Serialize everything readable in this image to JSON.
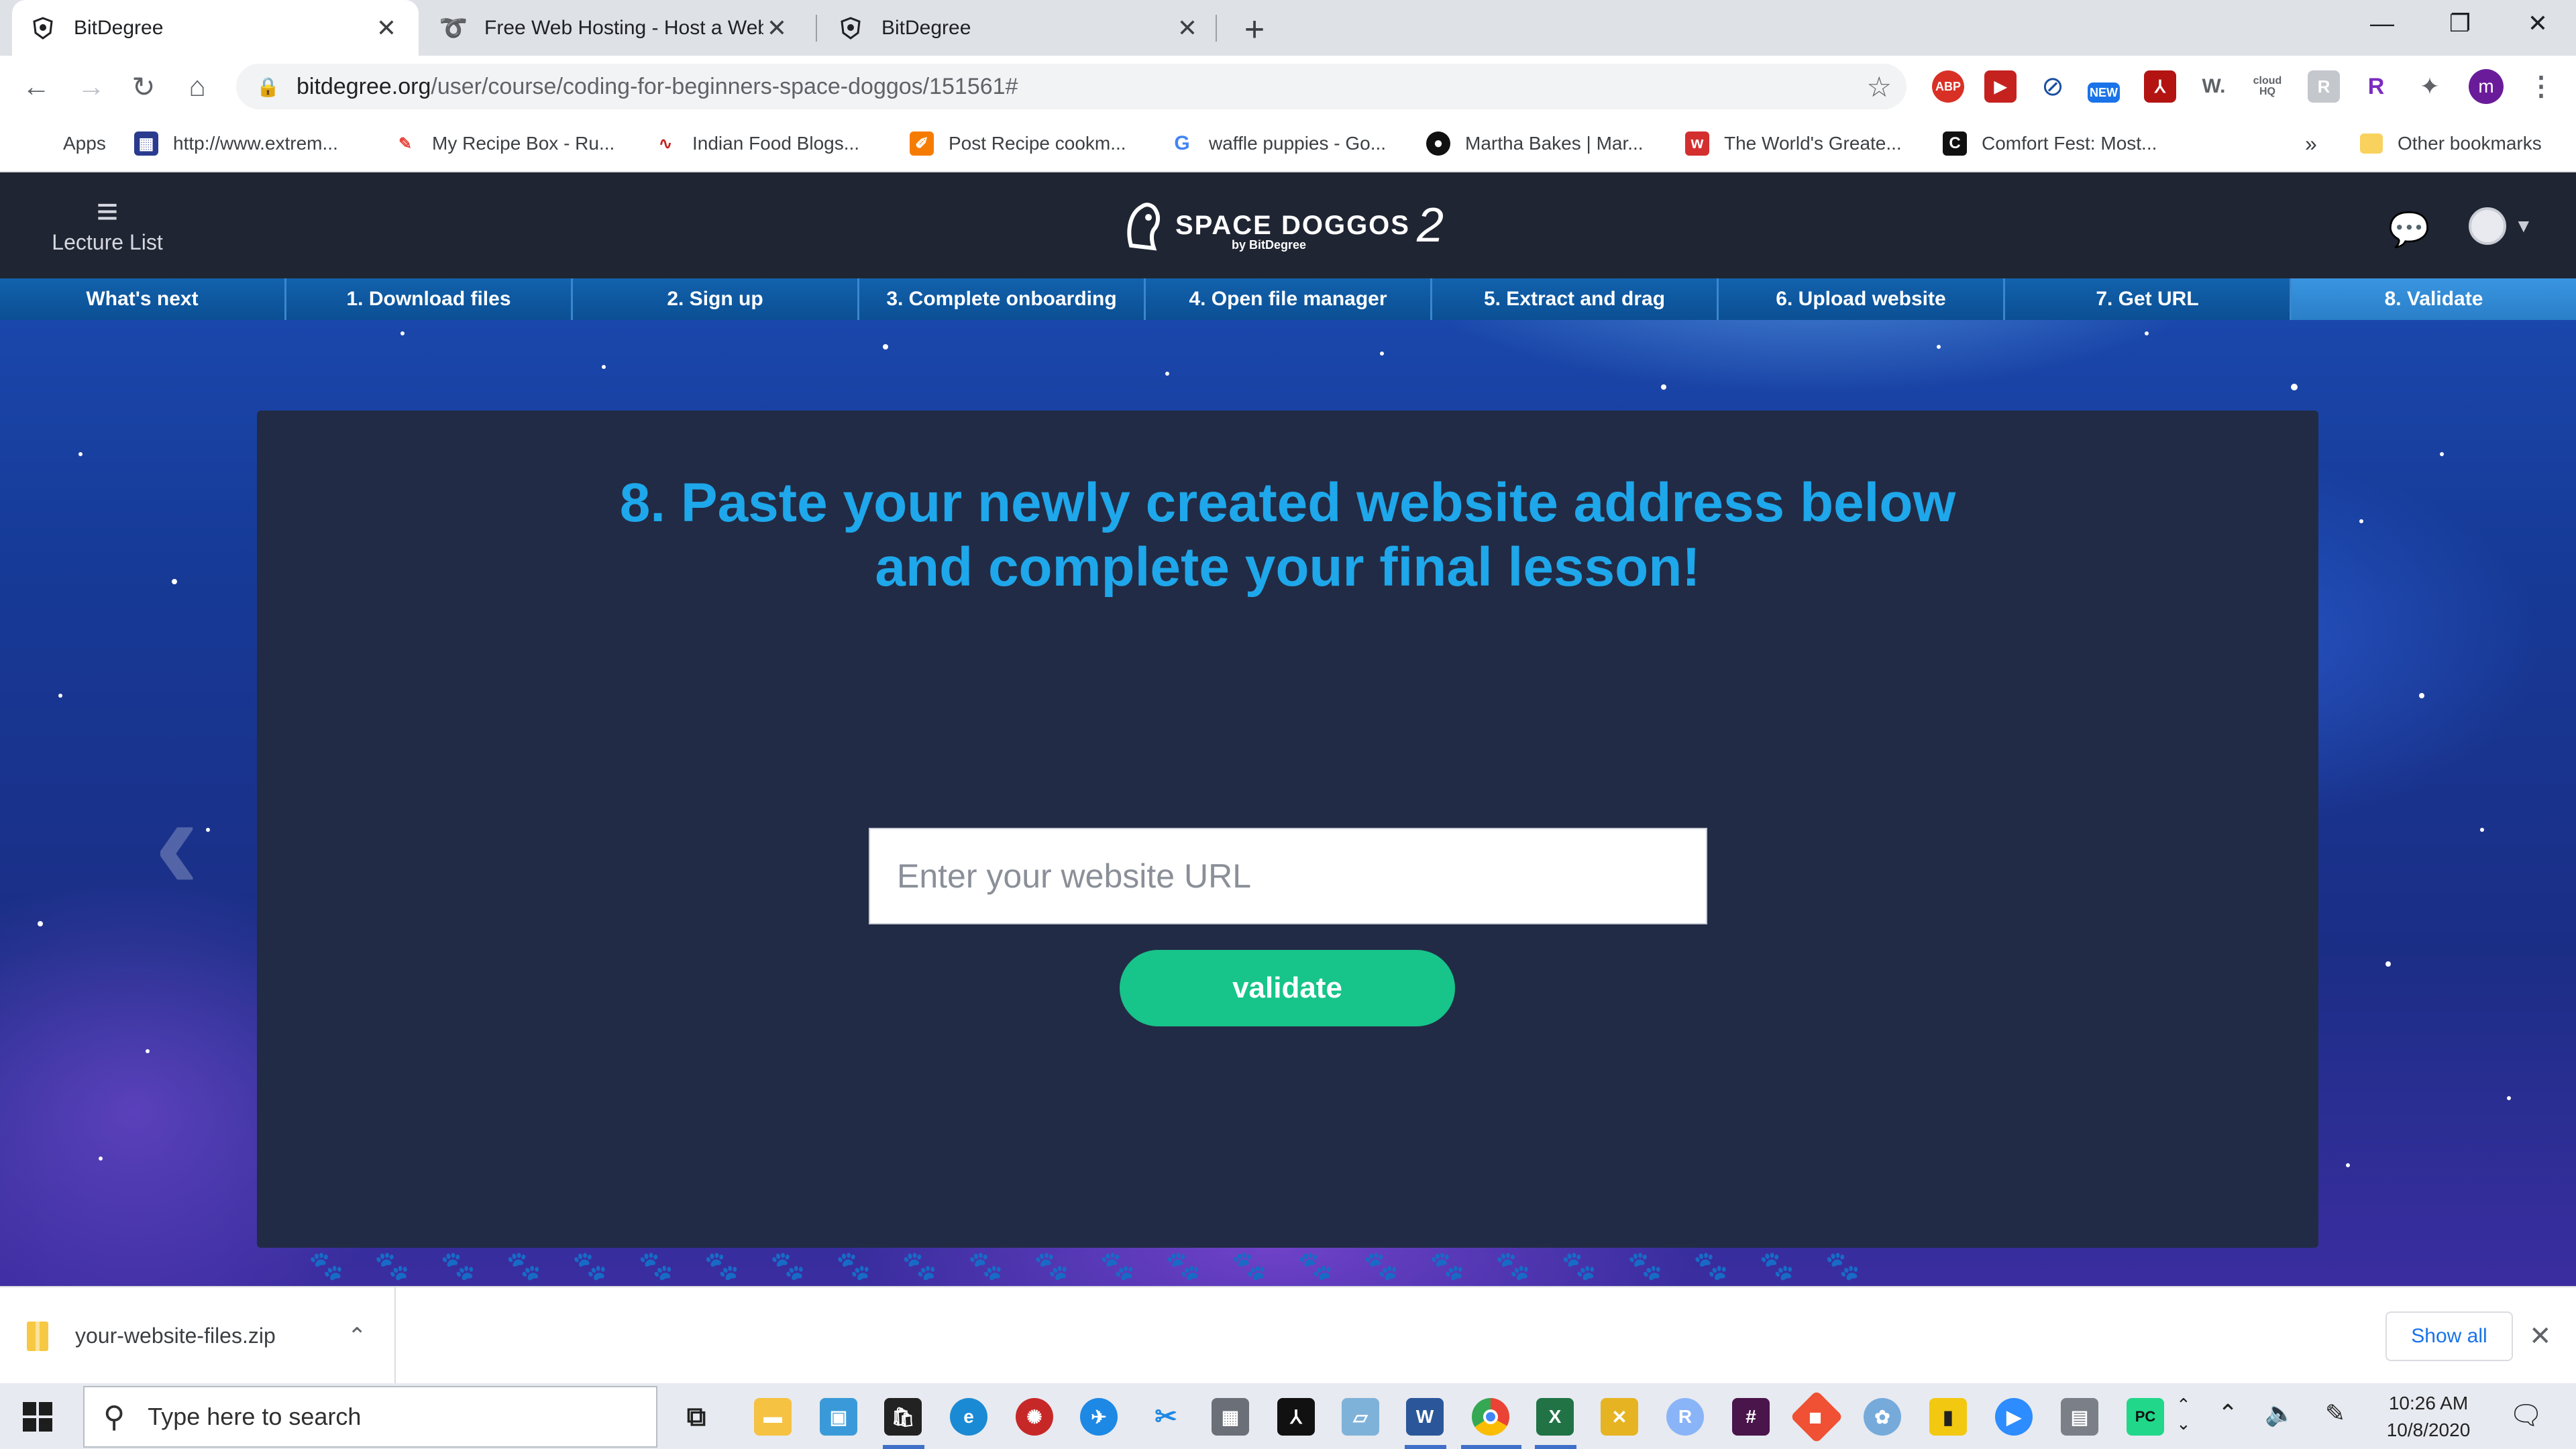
{
  "browser": {
    "tabs": [
      {
        "title": "BitDegree",
        "active": true
      },
      {
        "title": "Free Web Hosting - Host a Website",
        "active": false
      },
      {
        "title": "BitDegree",
        "active": false
      }
    ],
    "url_host": "bitdegree.org",
    "url_path": "/user/course/coding-for-beginners-space-doggos/151561#",
    "extensions": [
      "abp-icon",
      "playback-icon",
      "block-icon",
      "new-badge-icon",
      "pdf-icon",
      "w-icon",
      "cloudhq-icon",
      "r-icon",
      "r-purple-icon",
      "puzzle-icon"
    ],
    "extension_labels": {
      "abp": "ABP",
      "new": "NEW",
      "w": "W.",
      "cloud": "cloud HQ",
      "r": "R"
    },
    "profile_initial": "m"
  },
  "bookmarks": {
    "items": [
      {
        "label": "Apps"
      },
      {
        "label": "http://www.extrem..."
      },
      {
        "label": "My Recipe Box - Ru..."
      },
      {
        "label": "Indian Food Blogs..."
      },
      {
        "label": "Post Recipe cookm..."
      },
      {
        "label": "waffle puppies - Go..."
      },
      {
        "label": "Martha Bakes | Mar..."
      },
      {
        "label": "The World's Greate..."
      },
      {
        "label": "Comfort Fest: Most..."
      }
    ],
    "overflow": "»",
    "other": "Other bookmarks"
  },
  "site": {
    "lecture_list": "Lecture List",
    "logo_name": "SPACE DOGGOS",
    "logo_number": "2",
    "logo_by": "by BitDegree",
    "steps": [
      "What's next",
      "1. Download files",
      "2. Sign up",
      "3. Complete onboarding",
      "4. Open file manager",
      "5. Extract and drag",
      "6. Upload website",
      "7. Get URL",
      "8. Validate"
    ],
    "active_step": 8,
    "headline_line1": "8. Paste your newly created website address below",
    "headline_line2": "and complete your final lesson!",
    "url_placeholder": "Enter your website URL",
    "url_value": "",
    "validate_label": "validate",
    "colors": {
      "headline": "#1ea7ea",
      "validate": "#17c48a",
      "card": "#222b45",
      "steps": "#0d5ea8"
    }
  },
  "downloads": {
    "file": "your-website-files.zip",
    "show_all": "Show all"
  },
  "taskbar": {
    "search_placeholder": "Type here to search",
    "time": "10:26 AM",
    "date": "10/8/2020",
    "pinned": [
      "task-view-icon",
      "file-explorer-icon",
      "photos-icon",
      "store-icon",
      "edge-icon",
      "app-red-icon",
      "app-blue-icon",
      "snip-icon",
      "calculator-icon",
      "acrobat-icon",
      "notepad-icon",
      "word-icon",
      "chrome-icon",
      "excel-icon",
      "tools-icon",
      "r-icon",
      "slack-icon",
      "git-icon",
      "rstudio-icon",
      "powerbi-icon",
      "zoom-icon",
      "database-icon",
      "pycharm-icon"
    ]
  }
}
